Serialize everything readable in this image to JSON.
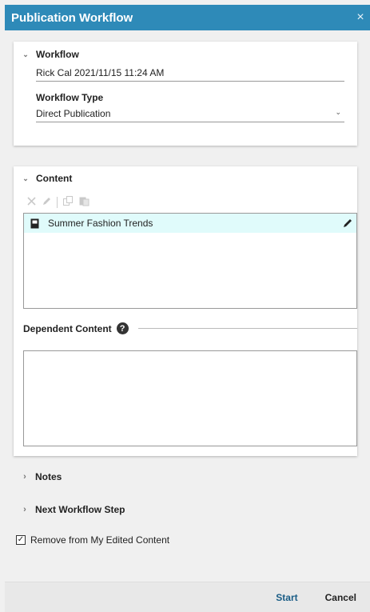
{
  "dialog": {
    "title": "Publication Workflow",
    "close_symbol": "×"
  },
  "workflow": {
    "heading": "Workflow",
    "name_value": "Rick Cal 2021/11/15 11:24 AM",
    "type_label": "Workflow Type",
    "type_value": "Direct Publication"
  },
  "content": {
    "heading": "Content",
    "toolbar_icons": [
      "remove-icon",
      "edit-icon",
      "copy-icon",
      "paste-icon"
    ],
    "items": [
      {
        "label": "Summer Fashion Trends",
        "icon": "document-icon"
      }
    ],
    "dependent_heading": "Dependent Content",
    "help_symbol": "?"
  },
  "sections": {
    "notes": "Notes",
    "next_step": "Next Workflow Step"
  },
  "options": {
    "remove_label": "Remove from My Edited Content",
    "remove_checked": true
  },
  "footer": {
    "start": "Start",
    "cancel": "Cancel"
  },
  "colors": {
    "titlebar": "#2e8ab8",
    "selected_row": "#e0fbfb",
    "start_text": "#1a5d86"
  }
}
